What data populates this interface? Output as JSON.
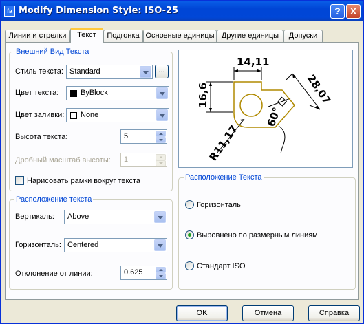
{
  "window": {
    "title": "Modify Dimension Style: ISO-25",
    "icon_label": "fa",
    "help_label": "?",
    "close_label": "X"
  },
  "tabs": [
    {
      "label": "Линии и стрелки",
      "active": false
    },
    {
      "label": "Текст",
      "active": true
    },
    {
      "label": "Подгонка",
      "active": false
    },
    {
      "label": "Основные единицы",
      "active": false
    },
    {
      "label": "Другие единицы",
      "active": false
    },
    {
      "label": "Допуски",
      "active": false
    }
  ],
  "appearance": {
    "title": "Внешний Вид Текста",
    "style_label": "Стиль текста:",
    "style_value": "Standard",
    "browse_label": "...",
    "color_label": "Цвет текста:",
    "color_value": "ByBlock",
    "color_swatch": "#000000",
    "fill_label": "Цвет заливки:",
    "fill_value": "None",
    "fill_swatch": "#ffffff",
    "height_label": "Высота текста:",
    "height_value": "5",
    "fraction_label": "Дробный масштаб высоты:",
    "fraction_value": "1",
    "frame_label": "Нарисовать рамки вокруг текста",
    "frame_checked": false
  },
  "placement": {
    "title": "Расположение текста",
    "vertical_label": "Вертикаль:",
    "vertical_value": "Above",
    "horizontal_label": "Горизонталь:",
    "horizontal_value": "Centered",
    "offset_label": "Отклонение от линии:",
    "offset_value": "0.625"
  },
  "preview": {
    "dim_top": "14,11",
    "dim_left": "16,6",
    "dim_angle_side": "28,07",
    "dim_angle": "60°",
    "dim_radius": "R11,17"
  },
  "alignment": {
    "title": "Расположение Текста",
    "options": [
      {
        "label": "Горизонталь",
        "checked": false
      },
      {
        "label": "Выровнено по размерным линиям",
        "checked": true
      },
      {
        "label": "Стандарт ISO",
        "checked": false
      }
    ]
  },
  "buttons": {
    "ok": "OK",
    "cancel": "Отмена",
    "help": "Справка"
  },
  "colors": {
    "title_bar": "#0054e3",
    "group_title": "#0046d5",
    "active_tab_accent": "#ffc83c",
    "drawing_shape": "#b08a00"
  }
}
